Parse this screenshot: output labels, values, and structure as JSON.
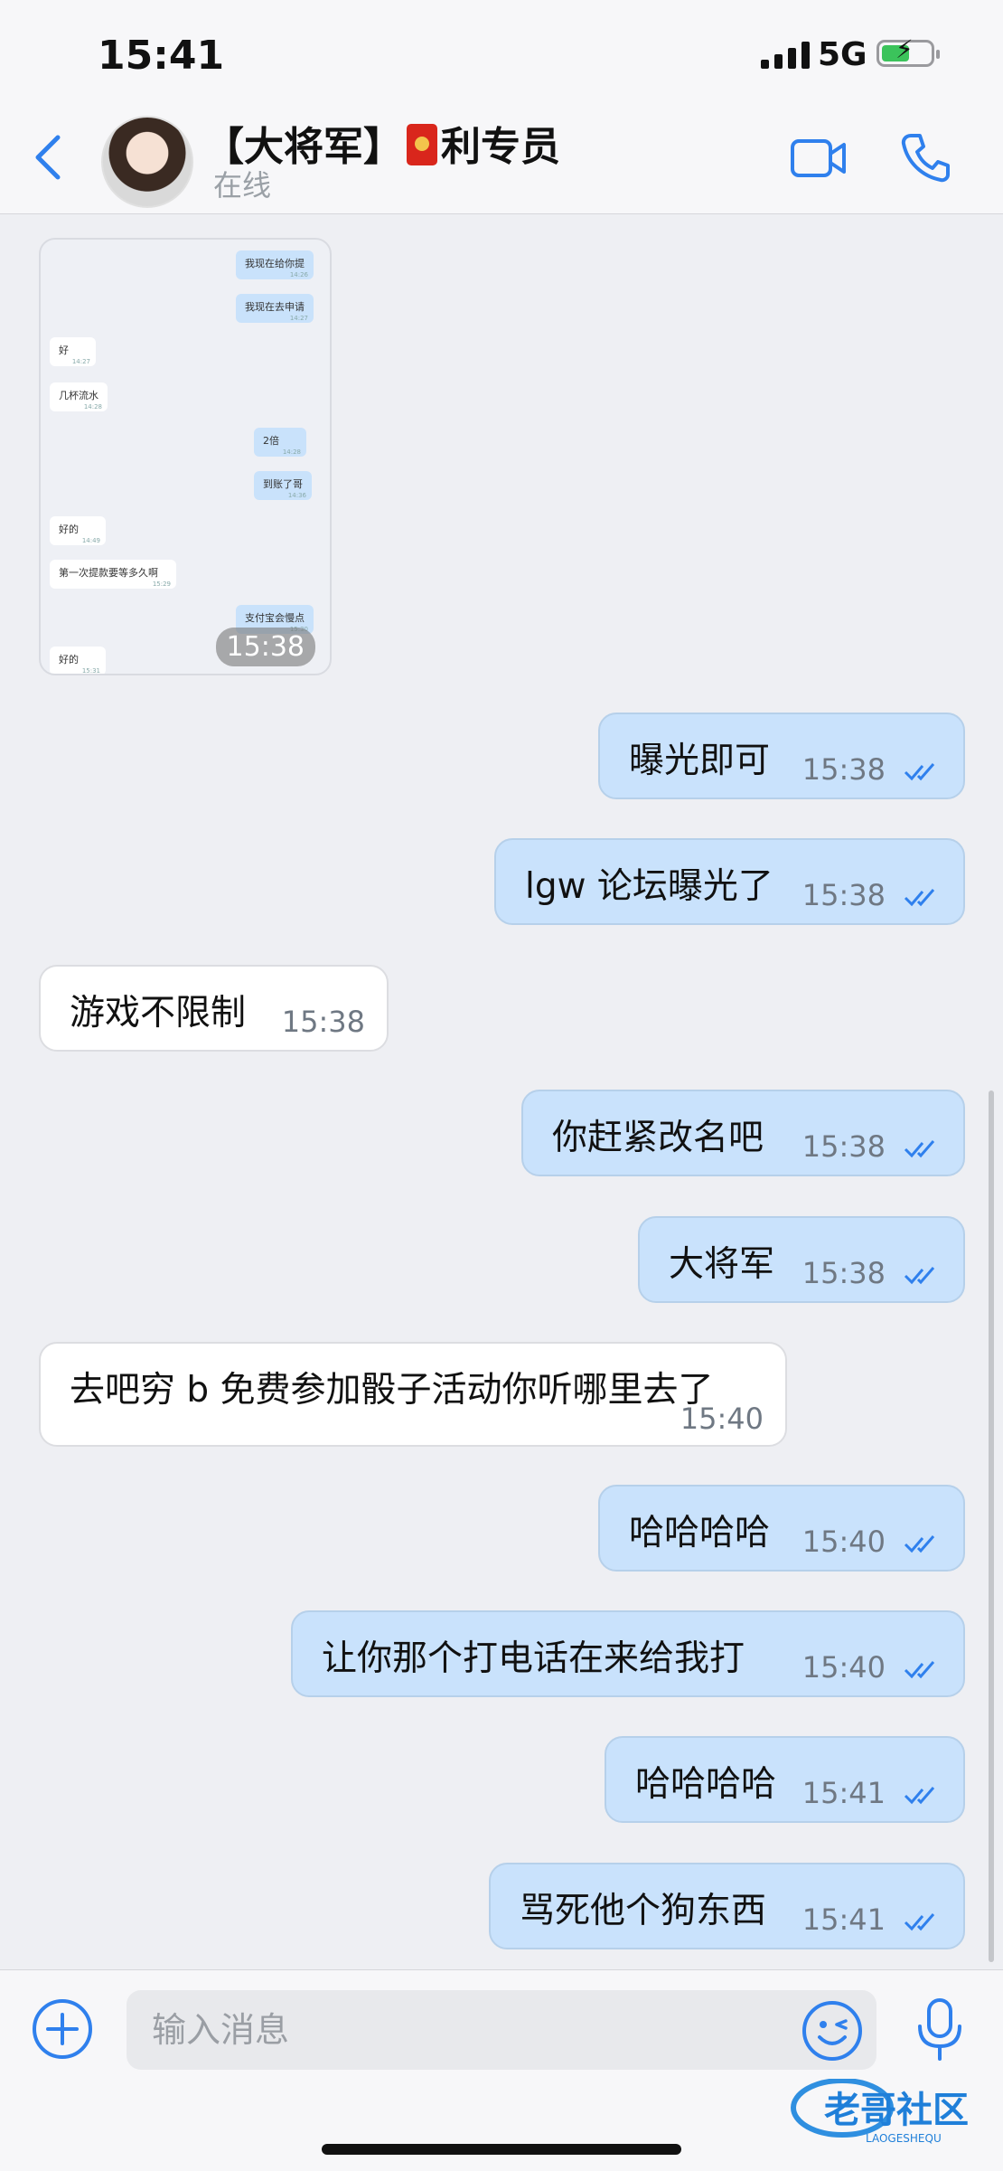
{
  "status_bar": {
    "time": "15:41",
    "network": "5G"
  },
  "header": {
    "name_prefix": "【大将军】",
    "name_suffix": "利专员",
    "status": "在线"
  },
  "screenshot_message": {
    "time": "15:38",
    "thumbnail_messages": [
      {
        "text": "我现在给你提",
        "time": "14:26",
        "side": "out"
      },
      {
        "text": "我现在去申请",
        "time": "14:27",
        "side": "out"
      },
      {
        "text": "好",
        "time": "14:27",
        "side": "in"
      },
      {
        "text": "几杯流水",
        "time": "14:28",
        "side": "in"
      },
      {
        "text": "2倍",
        "time": "14:28",
        "side": "out"
      },
      {
        "text": "到账了哥",
        "time": "14:36",
        "side": "out"
      },
      {
        "text": "好的",
        "time": "14:49",
        "side": "in"
      },
      {
        "text": "第一次提款要等多久啊",
        "time": "15:29",
        "side": "in"
      },
      {
        "text": "支付宝会慢点",
        "time": "15:30",
        "side": "out"
      },
      {
        "text": "好的",
        "time": "15:31",
        "side": "in"
      }
    ]
  },
  "messages": [
    {
      "text": "曝光即可",
      "time": "15:38",
      "side": "out"
    },
    {
      "text": "lgw 论坛曝光了",
      "time": "15:38",
      "side": "out"
    },
    {
      "text": "游戏不限制",
      "time": "15:38",
      "side": "in"
    },
    {
      "text": "你赶紧改名吧",
      "time": "15:38",
      "side": "out"
    },
    {
      "text": "大将军",
      "time": "15:38",
      "side": "out"
    },
    {
      "text": "去吧穷 b 免费参加骰子活动你听哪里去了",
      "time": "15:40",
      "side": "in"
    },
    {
      "text": "哈哈哈哈",
      "time": "15:40",
      "side": "out"
    },
    {
      "text": "让你那个打电话在来给我打",
      "time": "15:40",
      "side": "out"
    },
    {
      "text": "哈哈哈哈",
      "time": "15:41",
      "side": "out"
    },
    {
      "text": "骂死他个狗东西",
      "time": "15:41",
      "side": "out"
    }
  ],
  "input": {
    "placeholder": "输入消息"
  },
  "watermark": {
    "title": "老哥社区",
    "subtitle": "LAOGESHEQU"
  },
  "colors": {
    "accent": "#2f80ed",
    "outgoing_bubble": "#c9e2fc",
    "incoming_bubble": "#ffffff",
    "background": "#eeeff3"
  }
}
